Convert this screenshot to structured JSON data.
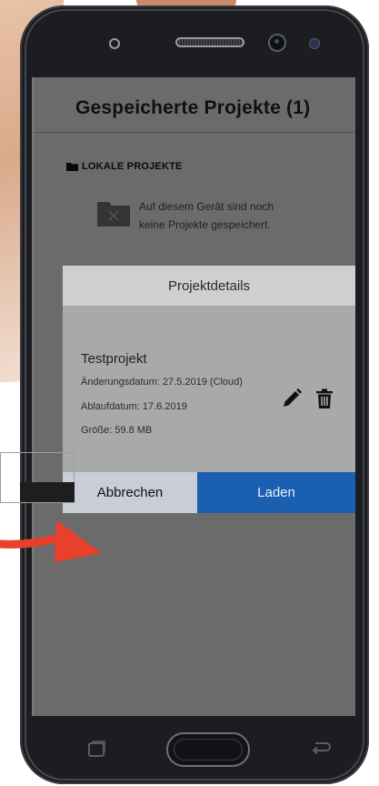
{
  "screen": {
    "title": "Gespeicherte Projekte (1)",
    "local_section": {
      "label": "LOKALE PROJEKTE",
      "icon": "folder-icon",
      "empty_message": "Auf diesem Gerät sind noch\nkeine Projekte gespeichert.",
      "empty_icon": "folder-x-icon"
    }
  },
  "dialog": {
    "title": "Projektdetails",
    "project": {
      "name": "Testprojekt",
      "modified": "Änderungsdatum: 27.5.2019 (Cloud)",
      "expires": "Ablaufdatum: 17.6.2019",
      "size": "Größe: 59.8 MB"
    },
    "actions": {
      "edit_icon": "pencil-icon",
      "delete_icon": "trash-icon"
    },
    "buttons": {
      "cancel": "Abbrechen",
      "load": "Laden"
    }
  },
  "colors": {
    "load_button": "#1a5fb0",
    "cancel_button": "#c9ced6",
    "arrow": "#e8402a",
    "phone_body": "#1c1d20"
  },
  "device_nav": {
    "recent_icon": "recent-apps-icon",
    "home_button": "home-button",
    "back_icon": "back-icon"
  }
}
